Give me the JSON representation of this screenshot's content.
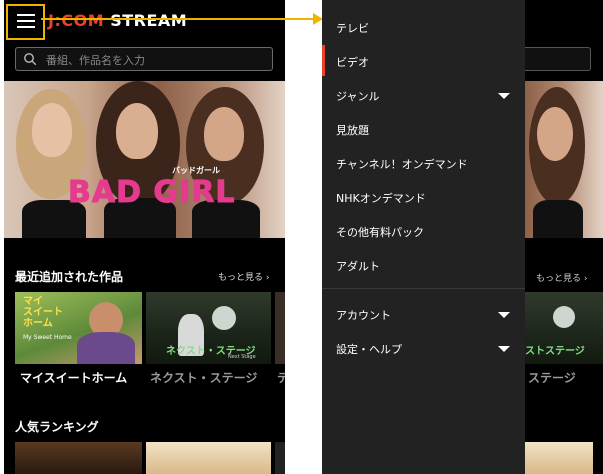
{
  "app": {
    "logo_prefix": "J:COM",
    "logo_suffix": "STREAM"
  },
  "search": {
    "placeholder": "番組、作品名を入力"
  },
  "hero": {
    "small_caption": "バッドガール",
    "title": "BAD GIRL"
  },
  "recent": {
    "title": "最近追加された作品",
    "more_label": "もっと見る",
    "items": [
      {
        "caption": "マイスイートホーム",
        "thumb_text": "マイ\nスイート\nホーム",
        "thumb_sub": "My Sweet Home"
      },
      {
        "caption": "ネクスト・ステージ",
        "thumb_text": "ネクスト・ステージ",
        "thumb_sub": "Next Stage"
      },
      {
        "caption": "テ"
      }
    ]
  },
  "ranking": {
    "title": "人気ランキング"
  },
  "right_bg": {
    "more_label": "もっと見る",
    "caption": "ステージ",
    "thumb_text": "ストステージ"
  },
  "menu": {
    "items": [
      {
        "label": "テレビ",
        "expandable": false,
        "active": false
      },
      {
        "label": "ビデオ",
        "expandable": false,
        "active": true
      },
      {
        "label": "ジャンル",
        "expandable": true,
        "active": false
      },
      {
        "label": "見放題",
        "expandable": false,
        "active": false
      },
      {
        "label": "チャンネル！オンデマンド",
        "expandable": false,
        "active": false
      },
      {
        "label": "NHKオンデマンド",
        "expandable": false,
        "active": false
      },
      {
        "label": "その他有料パック",
        "expandable": false,
        "active": false
      },
      {
        "label": "アダルト",
        "expandable": false,
        "active": false
      }
    ],
    "secondary": [
      {
        "label": "アカウント",
        "expandable": true
      },
      {
        "label": "設定・ヘルプ",
        "expandable": true
      }
    ]
  },
  "colors": {
    "accent": "#e8422a",
    "highlight": "#f0b400",
    "hero_title": "#e43b8f",
    "drawer_bg": "#222222"
  }
}
